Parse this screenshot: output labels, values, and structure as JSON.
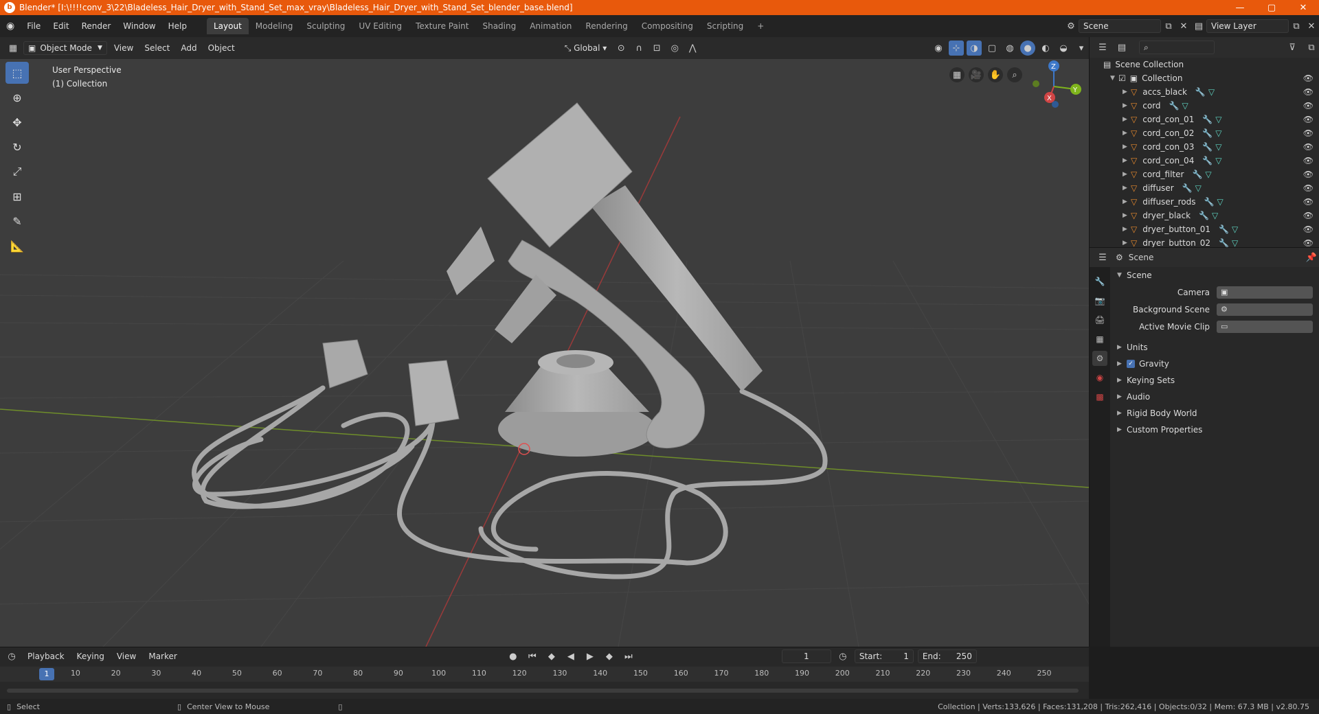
{
  "window": {
    "title": "Blender* [I:\\!!!!conv_3\\22\\Bladeless_Hair_Dryer_with_Stand_Set_max_vray\\Bladeless_Hair_Dryer_with_Stand_Set_blender_base.blend]",
    "minimize": "—",
    "maximize": "▢",
    "close": "✕"
  },
  "menu": [
    "File",
    "Edit",
    "Render",
    "Window",
    "Help"
  ],
  "workspaces": [
    "Layout",
    "Modeling",
    "Sculpting",
    "UV Editing",
    "Texture Paint",
    "Shading",
    "Animation",
    "Rendering",
    "Compositing",
    "Scripting"
  ],
  "workspace_add": "+",
  "scene_selector": "Scene",
  "view_layer": "View Layer",
  "viewport": {
    "mode": "Object Mode",
    "menus": [
      "View",
      "Select",
      "Add",
      "Object"
    ],
    "transform_orientation": "Global",
    "info_line1": "User Perspective",
    "info_line2": "(1) Collection",
    "axes": {
      "z": "Z",
      "y": "Y",
      "x": "X"
    }
  },
  "outliner": {
    "root": "Scene Collection",
    "collection": "Collection",
    "items": [
      "accs_black",
      "cord",
      "cord_con_01",
      "cord_con_02",
      "cord_con_03",
      "cord_con_04",
      "cord_filter",
      "diffuser",
      "diffuser_rods",
      "dryer_black",
      "dryer_button_01",
      "dryer_button_02"
    ]
  },
  "properties": {
    "context": "Scene",
    "section": "Scene",
    "fields": [
      {
        "label": "Camera",
        "value": ""
      },
      {
        "label": "Background Scene",
        "value": ""
      },
      {
        "label": "Active Movie Clip",
        "value": ""
      }
    ],
    "panels": [
      "Units",
      "Gravity",
      "Keying Sets",
      "Audio",
      "Rigid Body World",
      "Custom Properties"
    ],
    "gravity_enabled": true
  },
  "timeline": {
    "menus": [
      "Playback",
      "Keying",
      "View",
      "Marker"
    ],
    "current_frame": "1",
    "start_label": "Start:",
    "start": "1",
    "end_label": "End:",
    "end": "250",
    "ticks": [
      "1",
      "10",
      "20",
      "30",
      "40",
      "50",
      "60",
      "70",
      "80",
      "90",
      "100",
      "110",
      "120",
      "130",
      "140",
      "150",
      "160",
      "170",
      "180",
      "190",
      "200",
      "210",
      "220",
      "230",
      "240",
      "250"
    ]
  },
  "status": {
    "select": "Select",
    "center": "Center View to Mouse",
    "stats": "Collection | Verts:133,626 | Faces:131,208 | Tris:262,416 | Objects:0/32 | Mem: 67.3 MB | v2.80.75"
  },
  "colors": {
    "accent": "#4772b3",
    "titlebar": "#e8590c",
    "mesh": "#a7a7a7"
  }
}
